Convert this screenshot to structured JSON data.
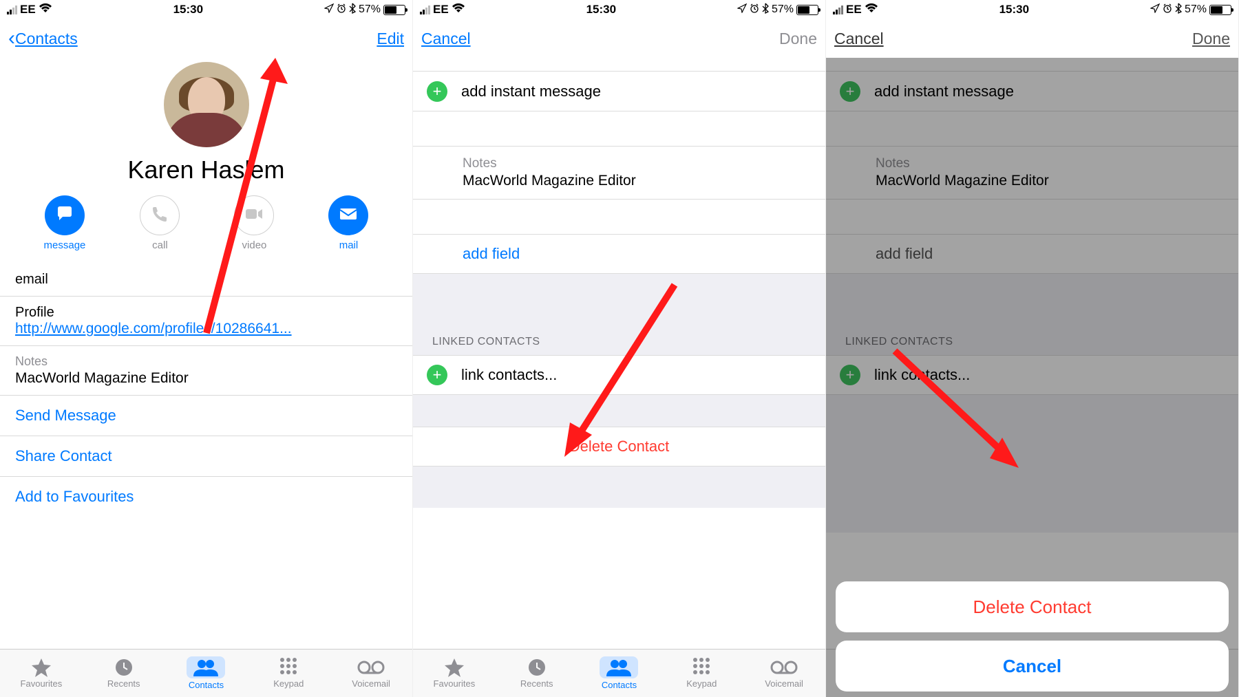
{
  "status_bar": {
    "carrier": "EE",
    "time": "15:30",
    "battery_pct": "57%",
    "battery_fill_pct": 57
  },
  "screen1": {
    "nav_back": "Contacts",
    "nav_edit": "Edit",
    "contact_name": "Karen Haslem",
    "actions": {
      "message": "message",
      "call": "call",
      "video": "video",
      "mail": "mail"
    },
    "email_label": "email",
    "profile_label": "Profile",
    "profile_url": "http://www.google.com/profiles/10286641...",
    "notes_label": "Notes",
    "notes_value": "MacWorld Magazine Editor",
    "send_message": "Send Message",
    "share_contact": "Share Contact",
    "add_to_favourites": "Add to Favourites"
  },
  "screen2": {
    "nav_cancel": "Cancel",
    "nav_done": "Done",
    "add_im": "add instant message",
    "notes_label": "Notes",
    "notes_value": "MacWorld Magazine Editor",
    "add_field": "add field",
    "linked_header": "LINKED CONTACTS",
    "link_contacts": "link contacts...",
    "delete_contact": "Delete Contact"
  },
  "screen3": {
    "nav_cancel": "Cancel",
    "nav_done": "Done",
    "add_im": "add instant message",
    "notes_label": "Notes",
    "notes_value": "MacWorld Magazine Editor",
    "add_field": "add field",
    "linked_header": "LINKED CONTACTS",
    "link_contacts": "link contacts...",
    "sheet_delete": "Delete Contact",
    "sheet_cancel": "Cancel"
  },
  "tabs": {
    "favourites": "Favourites",
    "recents": "Recents",
    "contacts": "Contacts",
    "keypad": "Keypad",
    "voicemail": "Voicemail"
  }
}
